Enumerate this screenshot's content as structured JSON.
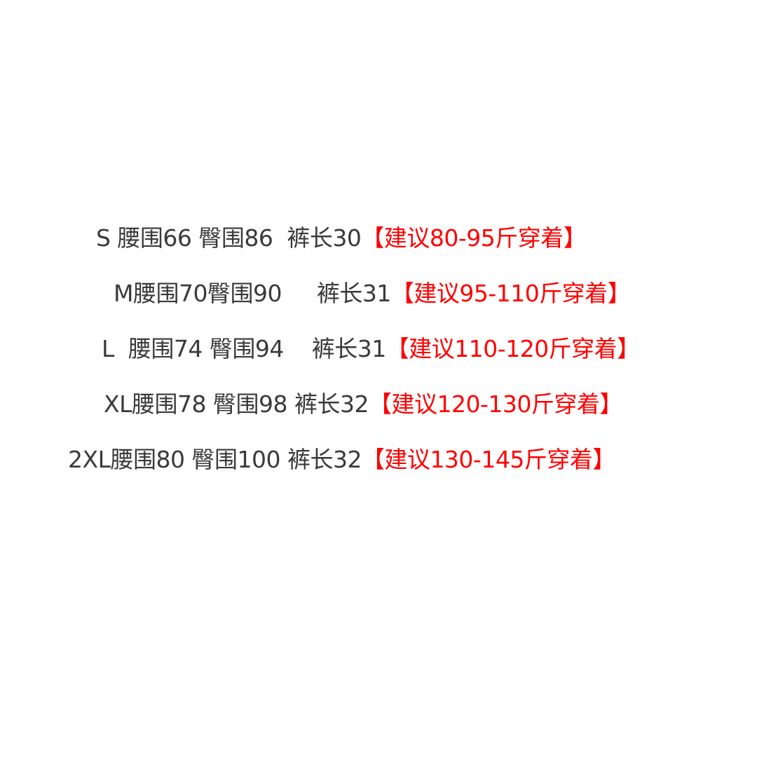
{
  "rows": [
    {
      "measurements": "S 腰围66 臀围86  裤长30",
      "recommendation": "【建议80-95斤穿着】"
    },
    {
      "measurements": "M腰围70臀围90     裤长31",
      "recommendation": "【建议95-110斤穿着】"
    },
    {
      "measurements": "L  腰围74 臀围94    裤长31",
      "recommendation": "【建议110-120斤穿着】"
    },
    {
      "measurements": "XL腰围78 臀围98 裤长32",
      "recommendation": "【建议120-130斤穿着】"
    },
    {
      "measurements": "2XL腰围80 臀围100 裤长32",
      "recommendation": "【建议130-145斤穿着】"
    }
  ],
  "colors": {
    "measurement_text": "#3a3a3a",
    "recommendation_text": "#ff0000",
    "background": "#ffffff"
  }
}
